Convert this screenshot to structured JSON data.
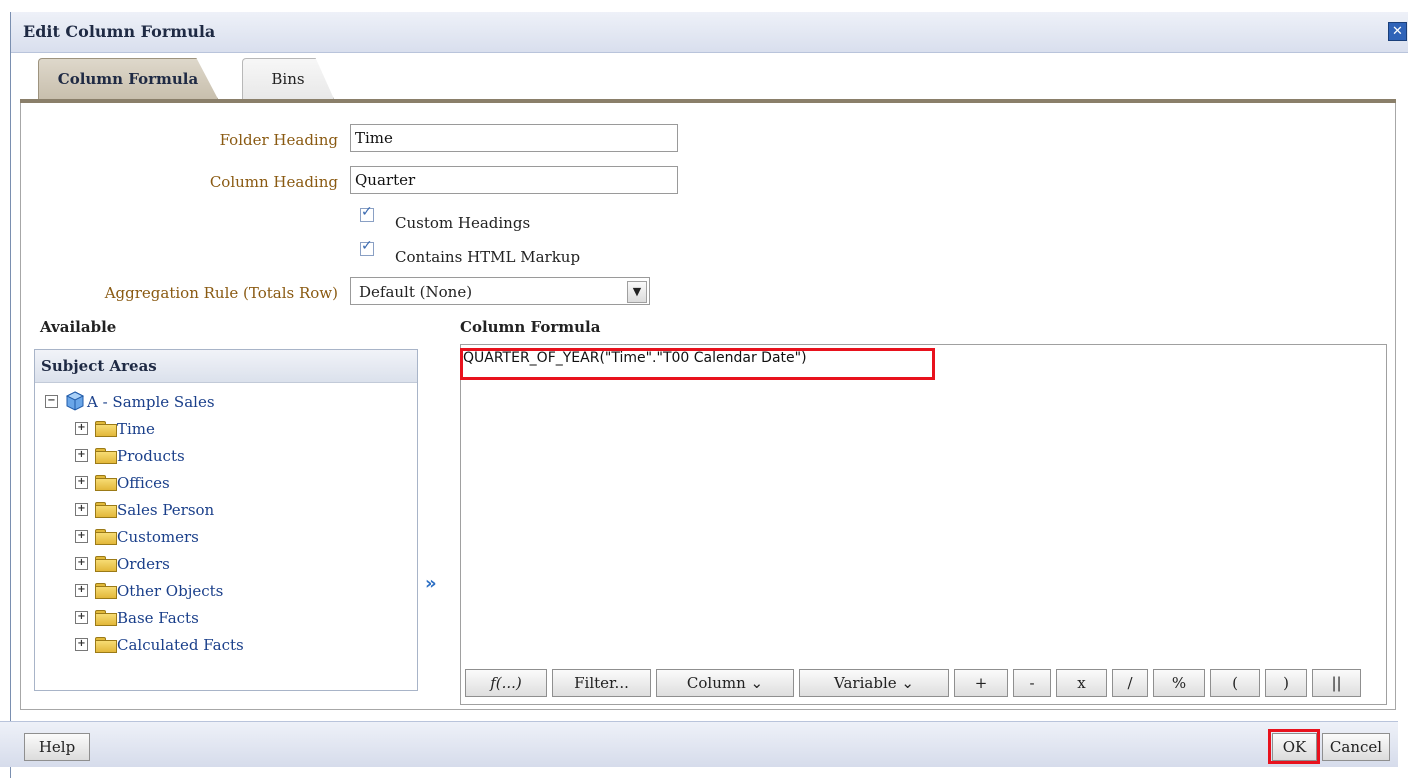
{
  "dialog": {
    "title": "Edit Column Formula",
    "close_symbol": "✕"
  },
  "tabs": [
    {
      "label": "Column Formula",
      "active": true
    },
    {
      "label": "Bins",
      "active": false
    }
  ],
  "form": {
    "folder_heading_label": "Folder Heading",
    "folder_heading_value": "Time",
    "column_heading_label": "Column Heading",
    "column_heading_value": "Quarter",
    "custom_headings_label": "Custom Headings",
    "custom_headings_checked": true,
    "html_markup_label": "Contains HTML Markup",
    "html_markup_checked": true,
    "aggregation_label": "Aggregation Rule (Totals Row)",
    "aggregation_value": "Default (None)"
  },
  "available": {
    "title": "Available",
    "panel_title": "Subject Areas",
    "root": "A - Sample Sales",
    "root_icon": "cube-icon",
    "folders": [
      "Time",
      "Products",
      "Offices",
      "Sales Person",
      "Customers",
      "Orders",
      "Other Objects",
      "Base Facts",
      "Calculated Facts"
    ]
  },
  "formula": {
    "title": "Column Formula",
    "text": "QUARTER_OF_YEAR(\"Time\".\"T00 Calendar Date\")",
    "toolbar": [
      "f(...)",
      "Filter...",
      "Column ⌄",
      "Variable ⌄",
      "+",
      "-",
      "x",
      "/",
      "%",
      "(",
      ")",
      "||"
    ]
  },
  "footer": {
    "help": "Help",
    "ok": "OK",
    "cancel": "Cancel"
  },
  "colors": {
    "label_brown": "#8a5a12",
    "link_blue": "#1a3f8a",
    "highlight_red": "#e8121d",
    "tab_active": "#c8bfad"
  }
}
